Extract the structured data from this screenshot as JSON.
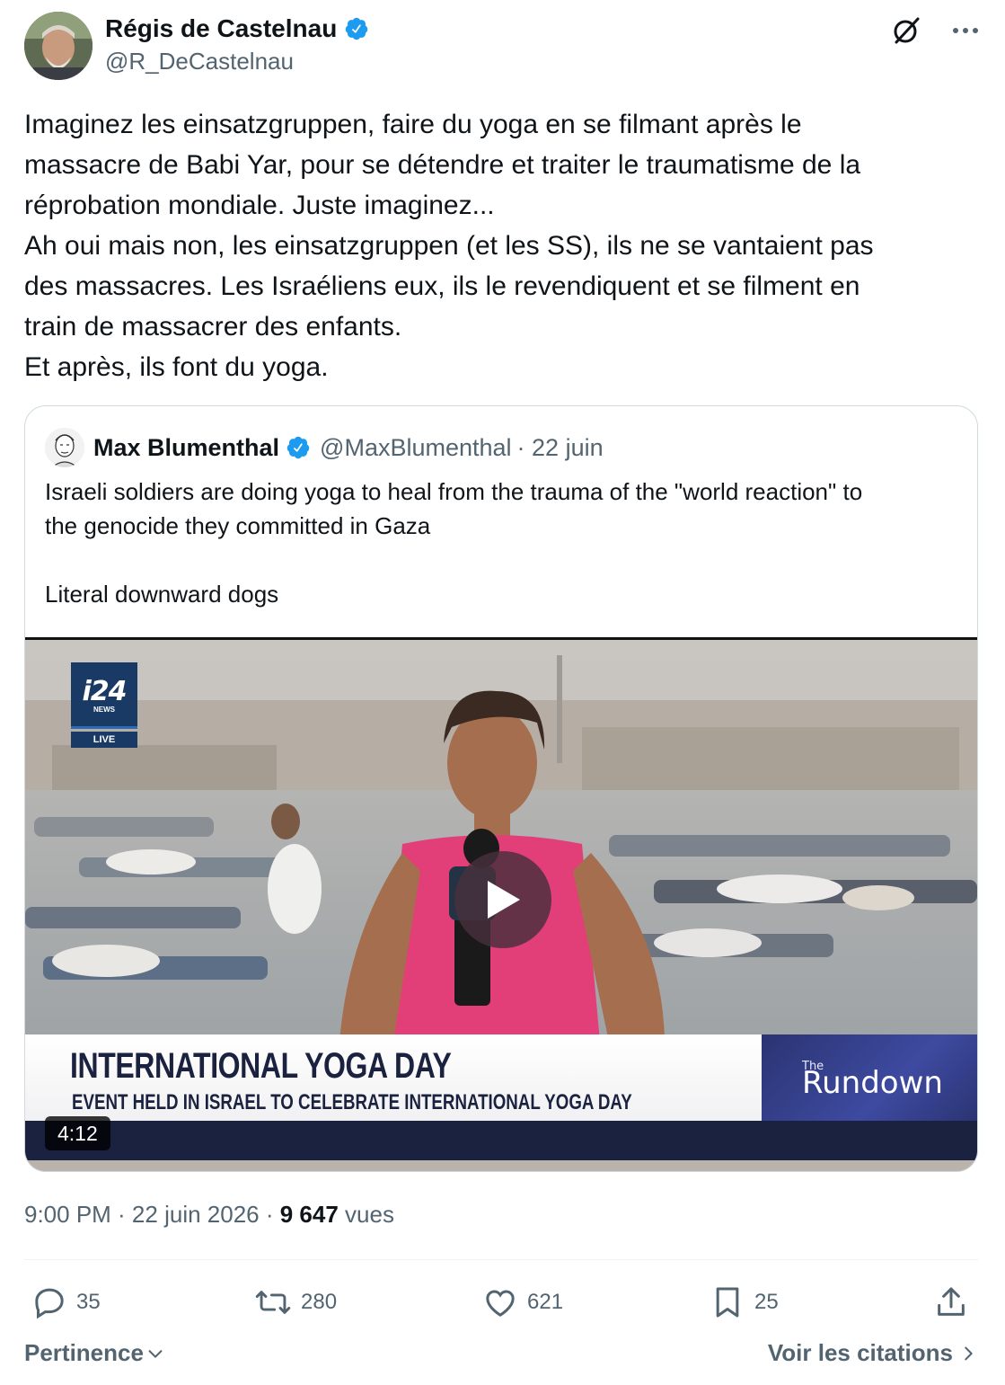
{
  "post": {
    "author_name": "Régis de Castelnau",
    "author_handle": "@R_DeCastelnau",
    "text_lines": [
      "Imaginez les einsatzgruppen, faire du yoga en se filmant après le",
      "massacre de Babi Yar, pour se détendre et traiter le traumatisme de la",
      "réprobation mondiale. Juste imaginez...",
      "Ah oui mais non, les einsatzgruppen (et les SS), ils ne se vantaient pas",
      "des massacres. Les Israéliens eux, ils le revendiquent et se filment en",
      "train de massacrer des enfants.",
      "Et après, ils font du yoga."
    ]
  },
  "quote": {
    "author_name": "Max Blumenthal",
    "author_handle": "@MaxBlumenthal",
    "date": "· 22 juin",
    "text_lines": [
      "Israeli soldiers are doing yoga to heal from the trauma of the \"world reaction\" to",
      "the genocide they committed in Gaza",
      " ",
      "Literal downward dogs"
    ],
    "video": {
      "logo": "i24",
      "logo_sub": "NEWS",
      "live_label": "LIVE",
      "banner_title": "INTERNATIONAL YOGA DAY",
      "banner_subtitle": "EVENT HELD IN ISRAEL TO CELEBRATE INTERNATIONAL YOGA DAY",
      "show_small": "The",
      "show_name": "Rundown",
      "duration": "4:12"
    }
  },
  "meta": {
    "time_date": "9:00 PM · 22 juin 2026 · ",
    "views_count": "9 647",
    "views_label": " vues"
  },
  "actions": {
    "replies": "35",
    "reposts": "280",
    "likes": "621",
    "bookmarks": "25"
  },
  "footer": {
    "sort_label": "Pertinence",
    "citations_label": "Voir les citations"
  },
  "colors": {
    "verified": "#1d9bf0",
    "text_primary": "#0f1419",
    "text_secondary": "#536471",
    "border": "#cfd9de"
  }
}
